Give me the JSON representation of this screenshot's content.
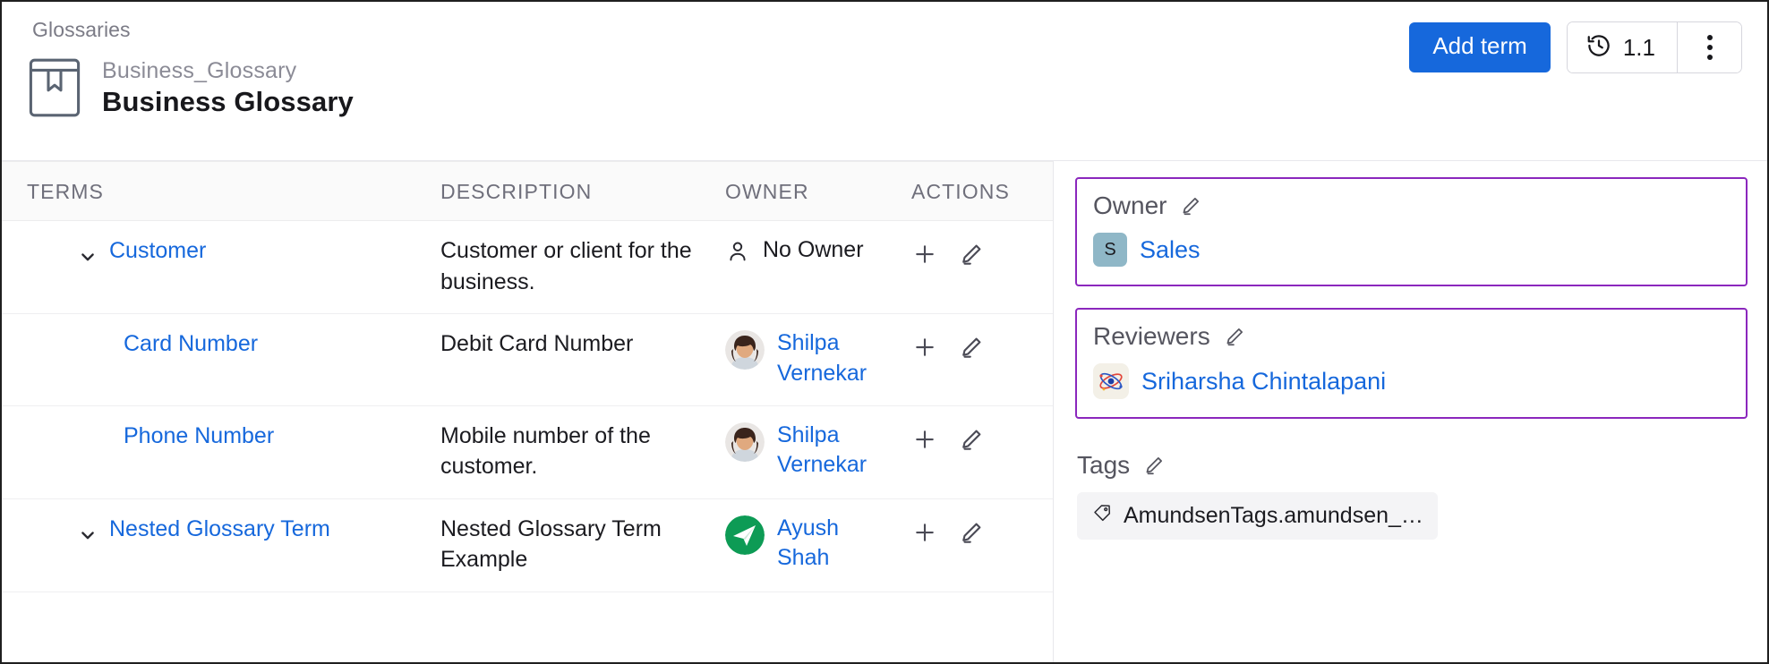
{
  "header": {
    "breadcrumb": "Glossaries",
    "fqn": "Business_Glossary",
    "display_name": "Business Glossary",
    "glossary_icon": "book-glossary-icon",
    "add_term_label": "Add term",
    "version_label": "1.1",
    "version_icon": "history-clock-icon",
    "more_icon": "vertical-dots-icon"
  },
  "table": {
    "columns": [
      "TERMS",
      "DESCRIPTION",
      "OWNER",
      "ACTIONS"
    ],
    "rows": [
      {
        "term": "Customer",
        "description": "Customer or client for the business.",
        "owner": "No Owner",
        "owner_type": "none",
        "owner_icon": "person-outline-icon",
        "indent": 0,
        "expandable": true,
        "add_icon": "plus-icon",
        "edit_icon": "pencil-icon"
      },
      {
        "term": "Card Number",
        "description": "Debit Card Number",
        "owner": "Shilpa Vernekar",
        "owner_type": "user",
        "owner_icon": "user-avatar-photo",
        "indent": 1,
        "expandable": false,
        "add_icon": "plus-icon",
        "edit_icon": "pencil-icon"
      },
      {
        "term": "Phone Number",
        "description": "Mobile number of the customer.",
        "owner": "Shilpa Vernekar",
        "owner_type": "user",
        "owner_icon": "user-avatar-photo",
        "indent": 1,
        "expandable": false,
        "add_icon": "plus-icon",
        "edit_icon": "pencil-icon"
      },
      {
        "term": "Nested Glossary Term",
        "description": "Nested Glossary Term Example",
        "owner": "Ayush Shah",
        "owner_type": "user",
        "owner_icon": "user-avatar-photo-green",
        "indent": 0,
        "expandable": true,
        "add_icon": "plus-icon",
        "edit_icon": "pencil-icon"
      }
    ]
  },
  "sidebar": {
    "owner": {
      "title": "Owner",
      "edit_icon": "pencil-icon",
      "value": "Sales",
      "badge_initial": "S",
      "badge_color": "#8fb7c7"
    },
    "reviewers": {
      "title": "Reviewers",
      "edit_icon": "pencil-icon",
      "value": "Sriharsha Chintalapani",
      "avatar_icon": "atom-avatar-icon"
    },
    "tags": {
      "title": "Tags",
      "edit_icon": "pencil-icon",
      "chip_label": "AmundsenTags.amundsen_…",
      "chip_icon": "tag-icon"
    },
    "highlight_color": "#8b27bd"
  }
}
